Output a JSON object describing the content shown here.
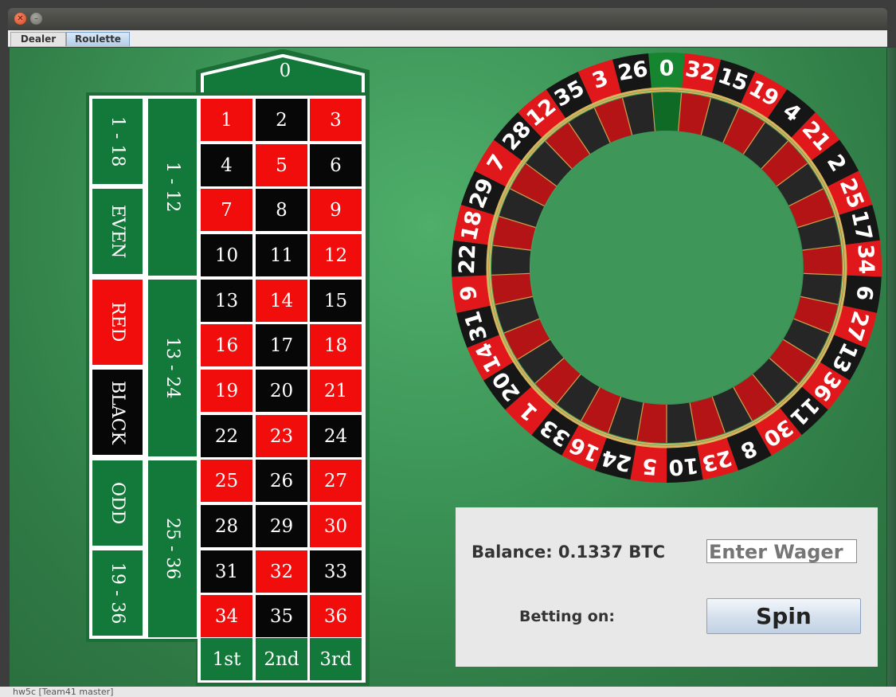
{
  "tabs": [
    {
      "label": "Dealer"
    },
    {
      "label": "Roulette"
    }
  ],
  "board": {
    "zero": "0",
    "numbers": [
      "1",
      "2",
      "3",
      "4",
      "5",
      "6",
      "7",
      "8",
      "9",
      "10",
      "11",
      "12",
      "13",
      "14",
      "15",
      "16",
      "17",
      "18",
      "19",
      "20",
      "21",
      "22",
      "23",
      "24",
      "25",
      "26",
      "27",
      "28",
      "29",
      "30",
      "31",
      "32",
      "33",
      "34",
      "35",
      "36"
    ],
    "red_numbers": [
      1,
      3,
      5,
      7,
      9,
      12,
      14,
      16,
      18,
      19,
      21,
      23,
      25,
      27,
      30,
      32,
      34,
      36
    ],
    "dozens": [
      "1 - 12",
      "13 - 24",
      "25 - 36"
    ],
    "outside": [
      "1 - 18",
      "EVEN",
      "RED",
      "BLACK",
      "ODD",
      "19 - 36"
    ],
    "columns": [
      "1st",
      "2nd",
      "3rd"
    ]
  },
  "wheel": {
    "order": [
      "0",
      "32",
      "15",
      "19",
      "4",
      "21",
      "2",
      "25",
      "17",
      "34",
      "6",
      "27",
      "13",
      "36",
      "11",
      "30",
      "8",
      "23",
      "10",
      "5",
      "24",
      "16",
      "33",
      "1",
      "20",
      "14",
      "31",
      "9",
      "22",
      "18",
      "29",
      "7",
      "28",
      "12",
      "35",
      "3",
      "26"
    ],
    "colors": {
      "red": "#e0181b",
      "black": "#161616",
      "green": "#16852f"
    }
  },
  "panel": {
    "balance": "Balance: 0.1337 BTC",
    "wager_placeholder": "Enter Wager",
    "betting_on": "Betting on:",
    "spin": "Spin"
  },
  "statusbar": {
    "text": "hw5c [Team41 master]"
  }
}
